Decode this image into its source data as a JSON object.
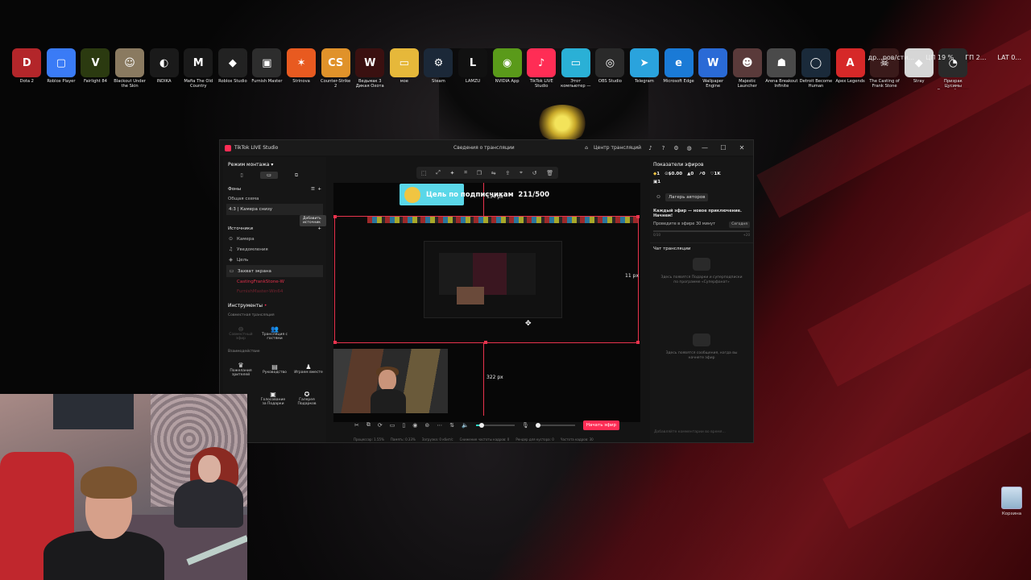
{
  "desktop": {
    "icons": [
      {
        "label": "Dota 2",
        "glyph": "D",
        "color": "#b3262a"
      },
      {
        "label": "Roblox Player",
        "glyph": "▢",
        "color": "#3a7bf6"
      },
      {
        "label": "Fairlight 84",
        "glyph": "V",
        "color": "#2b3a10"
      },
      {
        "label": "Blackout Under the Skin",
        "glyph": "☺",
        "color": "#8a7a60"
      },
      {
        "label": "INDIKA",
        "glyph": "◐",
        "color": "#1a1a1a"
      },
      {
        "label": "Mafia The Old Country",
        "glyph": "M",
        "color": "#1a1a1a"
      },
      {
        "label": "Roblox Studio",
        "glyph": "◆",
        "color": "#222"
      },
      {
        "label": "Furnish Master",
        "glyph": "▣",
        "color": "#2d2d2d"
      },
      {
        "label": "Strinova",
        "glyph": "✶",
        "color": "#e85a20"
      },
      {
        "label": "Counter-Strike 2",
        "glyph": "CS",
        "color": "#e0922a"
      },
      {
        "label": "Ведьмак 3 Дикая Охота",
        "glyph": "W",
        "color": "#3a1010"
      },
      {
        "label": "мое",
        "glyph": "▭",
        "color": "#e6b83a"
      },
      {
        "label": "Steam",
        "glyph": "⚙",
        "color": "#1b2838"
      },
      {
        "label": "LAMZU",
        "glyph": "L",
        "color": "#111"
      },
      {
        "label": "NVIDIA App",
        "glyph": "◉",
        "color": "#5a9a1a"
      },
      {
        "label": "TikTok LIVE Studio",
        "glyph": "♪",
        "color": "#ff2d55"
      },
      {
        "label": "Этот компьютер — ярлык",
        "glyph": "▭",
        "color": "#2ab0d6"
      },
      {
        "label": "OBS Studio",
        "glyph": "◎",
        "color": "#2a2a2a"
      },
      {
        "label": "Telegram",
        "glyph": "➤",
        "color": "#2aa3dd"
      },
      {
        "label": "Microsoft Edge",
        "glyph": "e",
        "color": "#1a7ad6"
      },
      {
        "label": "Wallpaper Engine",
        "glyph": "W",
        "color": "#2a6ad6"
      },
      {
        "label": "Majestic Launcher",
        "glyph": "☻",
        "color": "#5a3a3a"
      },
      {
        "label": "Arena Breakout Infinite",
        "glyph": "☗",
        "color": "#4a4a4a"
      },
      {
        "label": "Detroit Become Human",
        "glyph": "◯",
        "color": "#1a2a3a"
      },
      {
        "label": "Apex Legends",
        "glyph": "A",
        "color": "#d62828"
      },
      {
        "label": "The Casting of Frank Stone",
        "glyph": "☠",
        "color": "#3a1a1a"
      },
      {
        "label": "Stray",
        "glyph": "◆",
        "color": "#d6d6d6"
      },
      {
        "label": "Призрак Цусимы Режиссёрская в...",
        "glyph": "◔",
        "color": "#2a2a2a"
      }
    ],
    "tray": {
      "left_text": "др...ров/сти...",
      "cpu": "ЦП 19 %",
      "gpu": "ГП 2...",
      "lat": "LAT 0..."
    },
    "recycle_label": "Корзина"
  },
  "window": {
    "app_title": "TikTok LIVE Studio",
    "center_title": "Сведения о трансляции",
    "help_center": "Центр трансляций",
    "min_icon": "—",
    "max_icon": "☐",
    "close_icon": "✕"
  },
  "left_panel": {
    "mode": "Режим монтажа ▾",
    "scenes_title": "Фоны",
    "scene_items": [
      "Общая схема",
      "4:3 | Камера снизу"
    ],
    "tooltip": "Добавить источник",
    "sources_title": "Источники",
    "sources": [
      {
        "label": "Камера",
        "icon": "⊙"
      },
      {
        "label": "Уведомления",
        "icon": "♫"
      },
      {
        "label": "Цель",
        "icon": "◈"
      },
      {
        "label": "Захват экрана",
        "icon": "▭"
      },
      {
        "label": "CastingFrankStone-W",
        "icon": ""
      },
      {
        "label": "FurnishMaster-Win64",
        "icon": ""
      }
    ],
    "tools_title": "Инструменты",
    "group_joint": "Совместная трансляция",
    "joint_tools": [
      {
        "label": "Совместный эфир",
        "icon": "⊖",
        "dim": true
      },
      {
        "label": "Трансляция с гостями",
        "icon": "👥",
        "dim": false
      }
    ],
    "group_interaction": "Взаимодействие",
    "interaction_tools": [
      {
        "label": "Пожелания зрителей",
        "icon": "♛"
      },
      {
        "label": "Руководство",
        "icon": "▤"
      },
      {
        "label": "Играем вместе",
        "icon": "♟"
      }
    ],
    "more_tools": [
      {
        "label": "Голосование за Подарки",
        "icon": "▣"
      },
      {
        "label": "Галерея Подарков",
        "icon": "✪"
      }
    ],
    "truncated": "...ация"
  },
  "preview": {
    "goal_text": "Цель по подписчикам",
    "goal_value": "211/500",
    "goal_progress": 0.42,
    "measure_top": "154 px",
    "measure_right": "11 px",
    "measure_bottom": "322 px"
  },
  "bottom": {
    "go_live": "Начать эфир",
    "volume_level": 0.15,
    "mic_level": 0.05,
    "stats": [
      "Процессор: 1.55%",
      "Память: 0.33%",
      "Загрузка: 0 кбит/с",
      "Снижение частоты кадров: 0",
      "Рендер для кустора: 0",
      "Частота кадров: 30"
    ]
  },
  "right_panel": {
    "title": "Показатели эфиров",
    "metrics": {
      "diamonds": "1",
      "money": "$0.00",
      "gifts": "0",
      "shares": "0",
      "likes": "1K",
      "viewers": "1"
    },
    "camp_button": "Лагерь авторов",
    "promo_title": "Каждый эфир — новое приключение. Начнем!",
    "promo_task": "Проведите в эфире 30 минут",
    "promo_chip": "Сегодня",
    "promo_progress": "0/30",
    "promo_reward": "+20",
    "chat_title": "Чат трансляции",
    "empty_subs": "Здесь появятся Подарки и суперподписки по программе «Суперфанат»",
    "empty_msgs": "Здесь появятся сообщения, когда вы начнете эфир",
    "chat_placeholder": "Добавляйте комментарии во время..."
  }
}
